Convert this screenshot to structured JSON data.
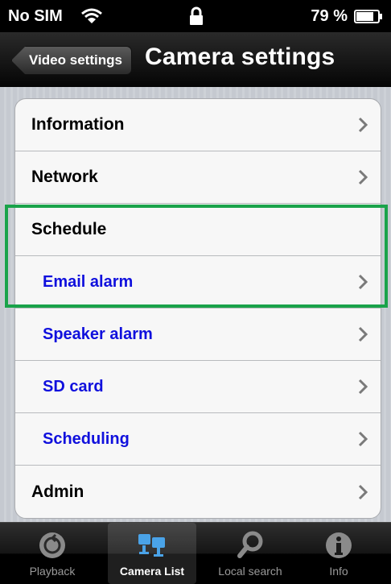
{
  "status_bar": {
    "carrier": "No SIM",
    "battery_percent": "79 %"
  },
  "nav_bar": {
    "back_label": "Video settings",
    "title": "Camera settings"
  },
  "menu": {
    "items": [
      {
        "label": "Information",
        "level": "top"
      },
      {
        "label": "Network",
        "level": "top"
      },
      {
        "label": "Schedule",
        "level": "section"
      },
      {
        "label": "Email alarm",
        "level": "sub"
      },
      {
        "label": "Speaker alarm",
        "level": "sub"
      },
      {
        "label": "SD card",
        "level": "sub"
      },
      {
        "label": "Scheduling",
        "level": "sub"
      },
      {
        "label": "Admin",
        "level": "top"
      }
    ]
  },
  "tab_bar": {
    "tabs": [
      {
        "label": "Playback",
        "icon": "playback-icon",
        "active": false
      },
      {
        "label": "Camera List",
        "icon": "camera-list-icon",
        "active": true
      },
      {
        "label": "Local search",
        "icon": "search-icon",
        "active": false
      },
      {
        "label": "Info",
        "icon": "info-icon",
        "active": false
      }
    ]
  },
  "colors": {
    "sub_item_text": "#1010dd",
    "highlight_border": "#1aa34a"
  }
}
